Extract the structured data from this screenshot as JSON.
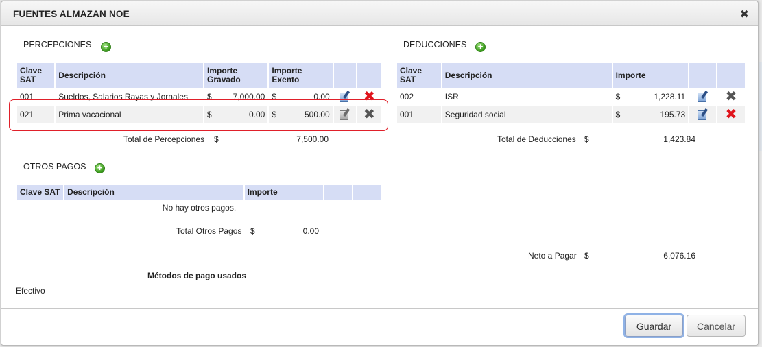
{
  "window": {
    "title": "FUENTES ALMAZAN NOE",
    "close_glyph": "✖"
  },
  "percepciones": {
    "label": "PERCEPCIONES",
    "columns": {
      "clave": "Clave SAT",
      "descripcion": "Descripción",
      "gravado": "Importe Gravado",
      "exento": "Importe Exento"
    },
    "rows": [
      {
        "clave": "001",
        "descripcion": "Sueldos, Salarios Rayas y Jornales",
        "gravado_cur": "$",
        "gravado": "7,000.00",
        "exento_cur": "$",
        "exento": "0.00"
      },
      {
        "clave": "021",
        "descripcion": "Prima vacacional",
        "gravado_cur": "$",
        "gravado": "0.00",
        "exento_cur": "$",
        "exento": "500.00"
      }
    ],
    "total_label": "Total de Percepciones",
    "total_cur": "$",
    "total": "7,500.00"
  },
  "deducciones": {
    "label": "DEDUCCIONES",
    "columns": {
      "clave": "Clave SAT",
      "descripcion": "Descripción",
      "importe": "Importe"
    },
    "rows": [
      {
        "clave": "002",
        "descripcion": "ISR",
        "importe_cur": "$",
        "importe": "1,228.11"
      },
      {
        "clave": "001",
        "descripcion": "Seguridad social",
        "importe_cur": "$",
        "importe": "195.73"
      }
    ],
    "total_label": "Total de Deducciones",
    "total_cur": "$",
    "total": "1,423.84"
  },
  "otros_pagos": {
    "label": "OTROS PAGOS",
    "columns": {
      "clave": "Clave SAT",
      "descripcion": "Descripción",
      "importe": "Importe"
    },
    "empty_text": "No hay otros pagos.",
    "total_label": "Total Otros Pagos",
    "total_cur": "$",
    "total": "0.00"
  },
  "neto": {
    "label": "Neto a Pagar",
    "cur": "$",
    "value": "6,076.16"
  },
  "metodos": {
    "heading": "Métodos de pago usados",
    "value": "Efectivo"
  },
  "buttons": {
    "save": "Guardar",
    "cancel": "Cancelar"
  },
  "colors": {
    "header_bg": "#d6ddf5",
    "highlight": "#e0202a",
    "add_green": "#3a9a1c",
    "delete_red": "#e0141c"
  }
}
